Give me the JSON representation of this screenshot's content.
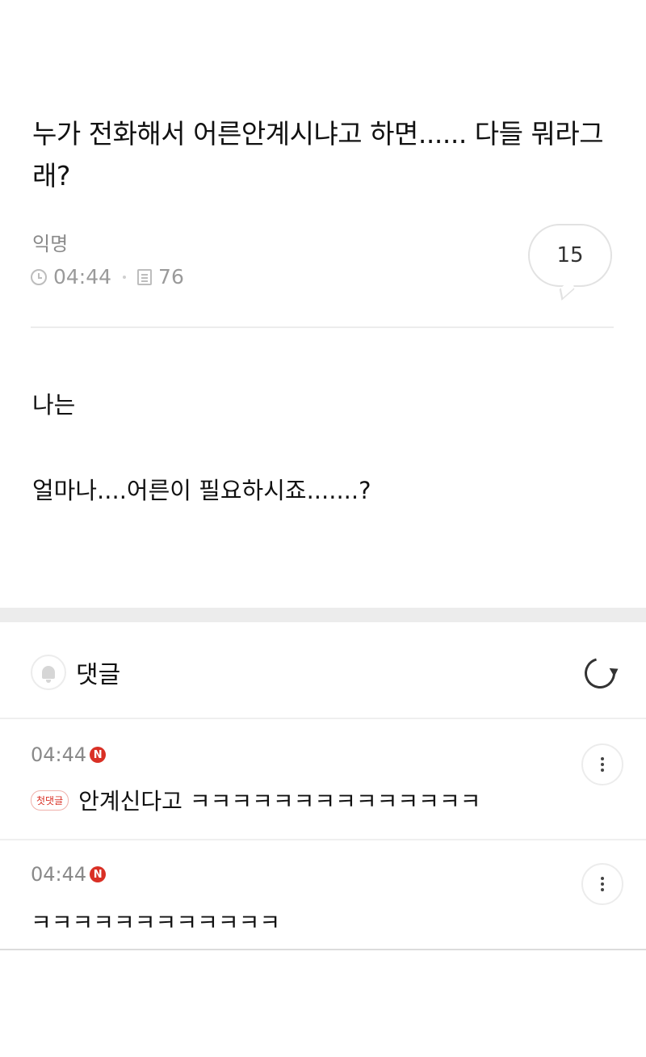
{
  "post": {
    "title": "누가 전화해서 어른안계시냐고 하면...... 다들 뭐라그래?",
    "author": "익명",
    "time": "04:44",
    "views": "76",
    "comment_count": "15",
    "body": [
      "나는",
      "얼마나....어른이 필요하시죠.......?"
    ]
  },
  "comments_section": {
    "title": "댓글",
    "comments": [
      {
        "time": "04:44",
        "new_badge": "N",
        "first_badge": "첫댓글",
        "text": "안계신다고 ㅋㅋㅋㅋㅋㅋㅋㅋㅋㅋㅋㅋㅋㅋ"
      },
      {
        "time": "04:44",
        "new_badge": "N",
        "text": "ㅋㅋㅋㅋㅋㅋㅋㅋㅋㅋㅋㅋ"
      }
    ]
  },
  "icons": {
    "clock": "clock-icon",
    "views": "document-icon",
    "bell": "bell-icon",
    "refresh": "refresh-icon",
    "more": "more-vertical-icon"
  },
  "colors": {
    "new_badge": "#d93025",
    "divider": "#ececec"
  }
}
